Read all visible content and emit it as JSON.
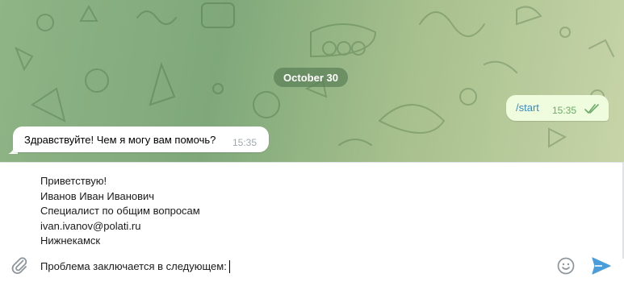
{
  "chat": {
    "date_label": "October 30",
    "outgoing": {
      "text": "/start",
      "time": "15:35",
      "status": "read"
    },
    "incoming": {
      "text": "Здравствуйте! Чем я могу вам помочь?",
      "time": "15:35"
    }
  },
  "composer": {
    "draft_lines": [
      "Приветствую!",
      "Иванов Иван Иванович",
      "Специалист по общим вопросам",
      "ivan.ivanov@polati.ru",
      "Нижнекамск"
    ],
    "current_line": "Проблема заключается в следующем:"
  },
  "icons": {
    "attach": "paperclip-icon",
    "emoji": "emoji-smile-icon",
    "send": "send-arrow-icon",
    "checks": "double-check-icon"
  },
  "colors": {
    "chat_background": "#8fb486",
    "outgoing_bubble": "#effdde",
    "incoming_bubble": "#ffffff",
    "accent": "#3a8ac4",
    "read_checks": "#6cab6a"
  }
}
